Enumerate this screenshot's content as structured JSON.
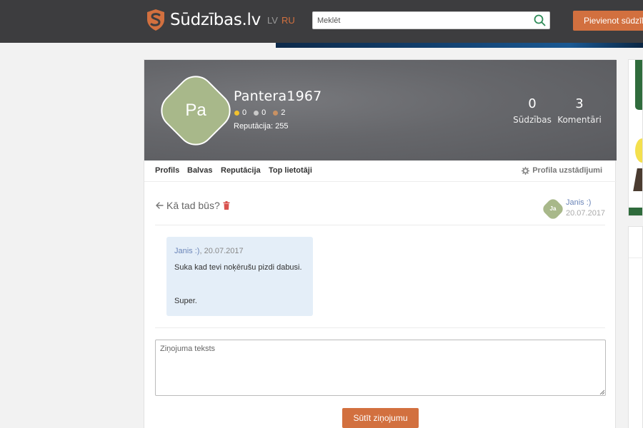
{
  "header": {
    "logo_text": "Sūdzības.lv",
    "lang_lv": "LV",
    "lang_ru": "RU",
    "search_placeholder": "Meklēt",
    "add_button": "Pievienot sūdzību",
    "accent_color": "#d2703f"
  },
  "profile": {
    "avatar_initials": "Pa",
    "username": "Pantera1967",
    "badges": [
      {
        "color": "#f2c12e",
        "count": "0"
      },
      {
        "color": "#c9c9c9",
        "count": "0"
      },
      {
        "color": "#c99163",
        "count": "2"
      }
    ],
    "reputation": "Reputācija: 255",
    "stats": [
      {
        "value": "0",
        "label": "Sūdzības"
      },
      {
        "value": "3",
        "label": "Komentāri"
      }
    ]
  },
  "nav": {
    "items": [
      "Profils",
      "Balvas",
      "Reputācija",
      "Top lietotāji"
    ],
    "settings": "Profila uzstādījumi"
  },
  "thread": {
    "title": "Kā tad būs?",
    "participant": {
      "initials": "Ja",
      "name": "Janis :)",
      "date": "20.07.2017"
    },
    "messages": [
      {
        "author": "Janis :)",
        "date": ", 20.07.2017",
        "line1": "Suka kad tevi noķērušu pizdi dabusi.",
        "line2": "Super."
      }
    ],
    "compose_placeholder": "Ziņojuma teksts",
    "send_button": "Sūtīt ziņojumu"
  }
}
